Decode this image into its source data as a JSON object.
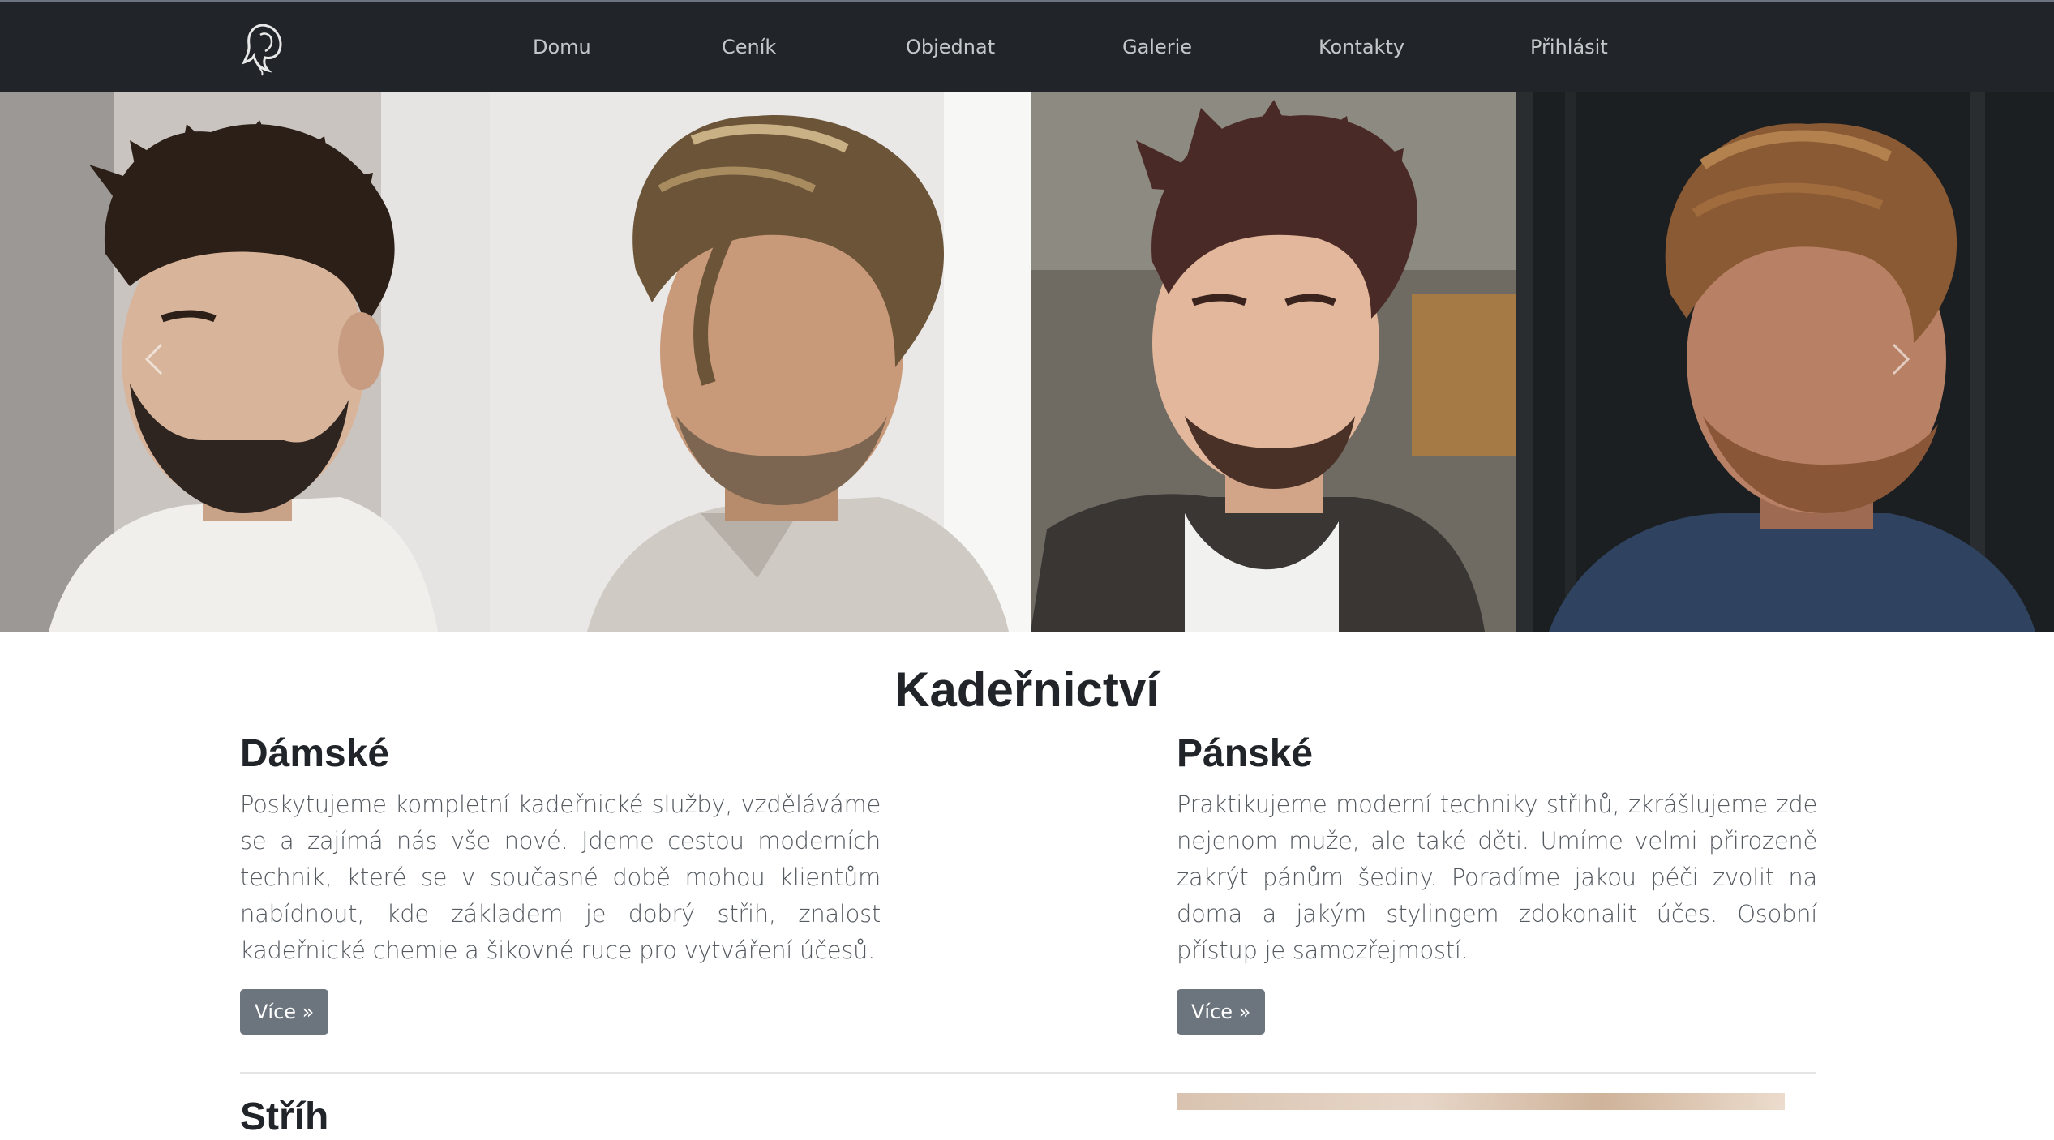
{
  "navbar": {
    "logo_icon": "woman-silhouette-logo-icon",
    "items": [
      {
        "label": "Domu"
      },
      {
        "label": "Ceník"
      },
      {
        "label": "Objednat"
      },
      {
        "label": "Galerie"
      },
      {
        "label": "Kontakty"
      },
      {
        "label": "Přihlásit"
      }
    ]
  },
  "carousel": {
    "prev_icon": "chevron-left-icon",
    "next_icon": "chevron-right-icon",
    "slides": [
      {
        "hair_color": "#2b1f18",
        "skin_color": "#d8b49a",
        "bg_color": "#c9c4c0",
        "shirt_color": "#f1efec"
      },
      {
        "hair_color": "#6b5438",
        "skin_color": "#c99a7a",
        "bg_color": "#e9e8e6",
        "shirt_color": "#cfcac3"
      },
      {
        "hair_color": "#4a2a26",
        "skin_color": "#e2b79b",
        "bg_color": "#6f6a62",
        "shirt_color": "#3a3634"
      },
      {
        "hair_color": "#8a5a34",
        "skin_color": "#b88064",
        "bg_color": "#1c1f22",
        "shirt_color": "#2f4360"
      }
    ]
  },
  "main": {
    "title": "Kadeřnictví",
    "columns": [
      {
        "heading": "Dámské",
        "text": "Poskytujeme kompletní kadeřnické služby, vzděláváme se a zajímá nás vše nové. Jdeme cestou moderních technik, které se v současné době mohou klientům nabídnout, kde základem je dobrý střih, znalost kadeřnické chemie a šikovné ruce pro vytváření účesů.",
        "button": "Více »"
      },
      {
        "heading": "Pánské",
        "text": "Praktikujeme moderní techniky střihů, zkrášlujeme zde nejenom muže, ale také děti. Umíme velmi přirozeně zakrýt pánům šediny. Poradíme jakou péči zvolit na doma a jakým stylingem zdokonalit účes. Osobní přístup je samozřejmostí.",
        "button": "Více »"
      }
    ],
    "next_heading": "Stříh"
  }
}
